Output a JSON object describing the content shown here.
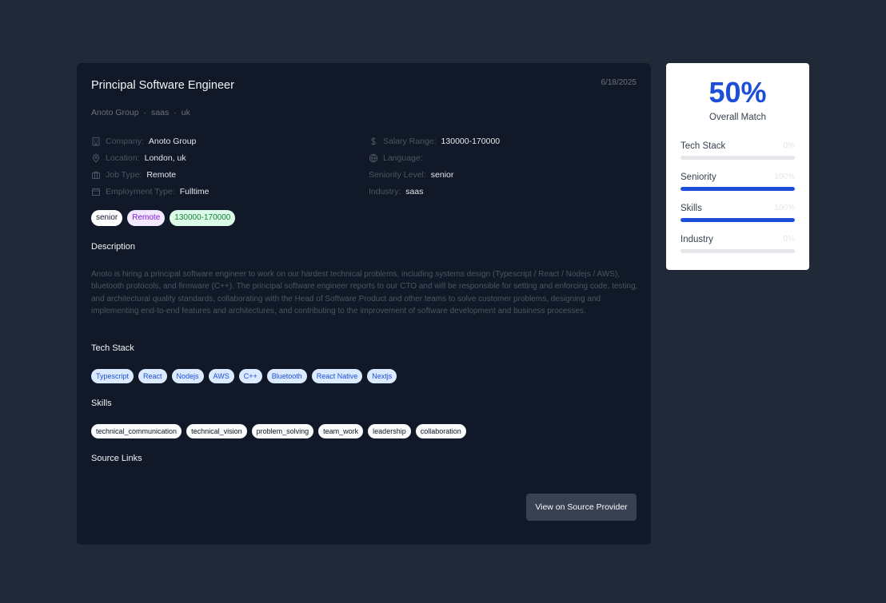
{
  "job": {
    "title": "Principal Software Engineer",
    "date": "6/18/2025",
    "subline": [
      "Anoto Group",
      "saas",
      "uk"
    ],
    "details_left": [
      {
        "icon": "building-icon",
        "label": "Company:",
        "value": "Anoto Group"
      },
      {
        "icon": "location-pin-icon",
        "label": "Location:",
        "value": "London, uk"
      },
      {
        "icon": "briefcase-icon",
        "label": "Job Type:",
        "value": "Remote"
      },
      {
        "icon": "calendar-icon",
        "label": "Employment Type:",
        "value": "Fulltime"
      }
    ],
    "details_right": [
      {
        "icon": "dollar-icon",
        "label": "Salary Range:",
        "value": "130000-170000"
      },
      {
        "icon": "globe-icon",
        "label": "Language:",
        "value": ""
      },
      {
        "icon": "",
        "label": "Seniority Level:",
        "value": "senior"
      },
      {
        "icon": "",
        "label": "Industry:",
        "value": "saas"
      }
    ],
    "tags": [
      {
        "text": "senior",
        "style": "white"
      },
      {
        "text": "Remote",
        "style": "purple"
      },
      {
        "text": "130000-170000",
        "style": "green"
      }
    ],
    "description_heading": "Description",
    "description": "Anoto is hiring a principal software engineer to work on our hardest technical problems, including systems design (Typescript / React / Nodejs / AWS), bluetooth protocols, and firmware (C++). The principal software engineer reports to our CTO and will be responsible for setting and enforcing code, testing, and architectural quality standards, collaborating with the Head of Software Product and other teams to solve customer problems, designing and implementing end-to-end features and architectures, and contributing to the improvement of software development and business processes.",
    "tech_stack_heading": "Tech Stack",
    "tech_stack": [
      "Typescript",
      "React",
      "Nodejs",
      "AWS",
      "C++",
      "Bluetooth",
      "React Native",
      "Nextjs"
    ],
    "skills_heading": "Skills",
    "skills": [
      "technical_communication",
      "technical_vision",
      "problem_solving",
      "team_work",
      "leadership",
      "collaboration"
    ],
    "source_links_heading": "Source Links",
    "source_button": "View on Source Provider"
  },
  "match": {
    "overall": "50%",
    "overall_label": "Overall Match",
    "metrics": [
      {
        "name": "Tech Stack",
        "value": "0%",
        "level": 0
      },
      {
        "name": "Seniority",
        "value": "100%",
        "level": 100
      },
      {
        "name": "Skills",
        "value": "100%",
        "level": 100
      },
      {
        "name": "Industry",
        "value": "0%",
        "level": 0
      }
    ]
  },
  "colors": {
    "accent": "#1d4ed8",
    "card_bg": "#111827",
    "page_bg": "#1f2937"
  }
}
